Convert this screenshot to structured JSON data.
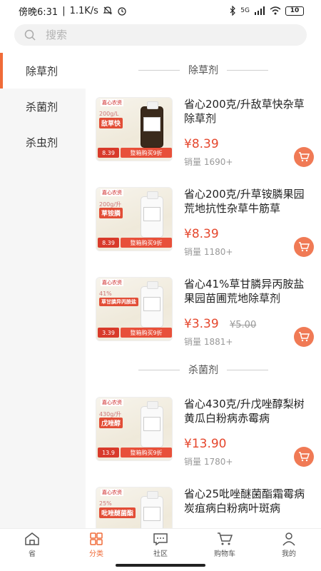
{
  "status_bar": {
    "time": "傍晚6:31",
    "speed": "1.1K/s",
    "signal": "5G",
    "battery": "10"
  },
  "search": {
    "placeholder": "搜索"
  },
  "sidebar": {
    "items": [
      {
        "label": "除草剂",
        "active": true
      },
      {
        "label": "杀菌剂",
        "active": false
      },
      {
        "label": "杀虫剂",
        "active": false
      }
    ]
  },
  "sections": [
    {
      "title": "除草剂",
      "products": [
        {
          "title": "省心200克/升敌草快杂草除草剂",
          "price": "¥8.39",
          "old_price": "",
          "sales": "销量 1690+",
          "thumb": {
            "brand": "嘉心农资",
            "spec": "200g/L",
            "name": "敌草快",
            "price": "8.39",
            "promo": "整箱购买9折"
          }
        },
        {
          "title": "省心200克/升草铵膦果园荒地抗性杂草牛筋草",
          "price": "¥8.39",
          "old_price": "",
          "sales": "销量 1180+",
          "thumb": {
            "brand": "嘉心农资",
            "spec": "200g/升",
            "name": "草铵膦",
            "price": "8.39",
            "promo": "整箱购买9折"
          }
        },
        {
          "title": "省心41%草甘膦异丙胺盐果园苗圃荒地除草剂",
          "price": "¥3.39",
          "old_price": "¥5.00",
          "sales": "销量 1881+",
          "thumb": {
            "brand": "嘉心农资",
            "spec": "41%",
            "name": "草甘膦异丙胺盐",
            "price": "3.39",
            "promo": "整箱购买9折"
          }
        }
      ]
    },
    {
      "title": "杀菌剂",
      "products": [
        {
          "title": "省心430克/升戊唑醇梨树黄瓜白粉病赤霉病",
          "price": "¥13.90",
          "old_price": "",
          "sales": "销量 1780+",
          "thumb": {
            "brand": "嘉心农资",
            "spec": "430g/升",
            "name": "戊唑醇",
            "price": "13.9",
            "promo": "整箱购买9折"
          }
        },
        {
          "title": "省心25吡唑醚菌酯霜霉病炭疽病白粉病叶斑病",
          "price": "",
          "old_price": "",
          "sales": "",
          "thumb": {
            "brand": "嘉心农资",
            "spec": "25%",
            "name": "吡唑醚菌酯",
            "price": "",
            "promo": ""
          }
        }
      ]
    }
  ],
  "tabbar": {
    "items": [
      {
        "label": "省",
        "icon": "home-icon"
      },
      {
        "label": "分类",
        "icon": "category-icon",
        "active": true
      },
      {
        "label": "社区",
        "icon": "community-icon"
      },
      {
        "label": "购物车",
        "icon": "cart-icon"
      },
      {
        "label": "我的",
        "icon": "profile-icon"
      }
    ]
  },
  "colors": {
    "accent": "#f06b38",
    "price": "#e5472d",
    "cart_button": "#f07a55"
  }
}
